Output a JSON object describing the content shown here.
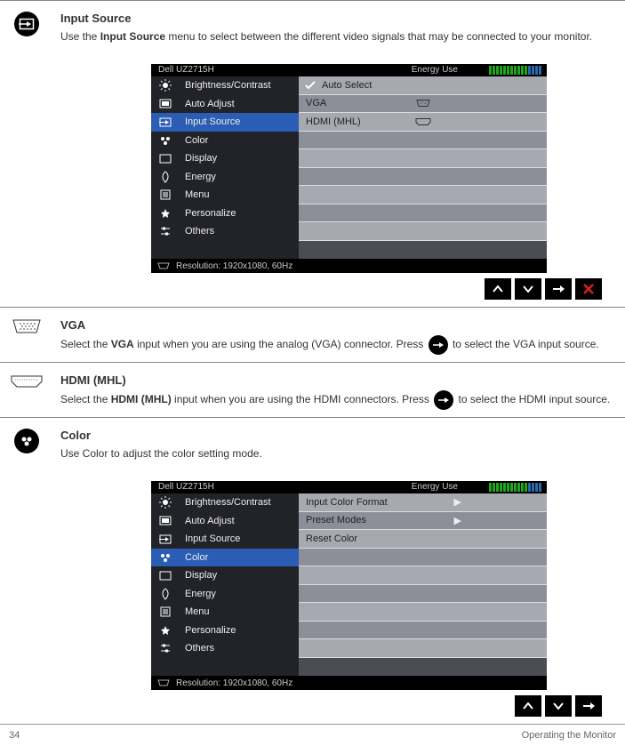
{
  "sections": {
    "input_source": {
      "title": "Input Source",
      "desc_prefix": "Use the ",
      "desc_mid": " menu to select between the different video signals that may be connected to your monitor."
    },
    "vga": {
      "title": "VGA",
      "desc_prefix": "Select the ",
      "desc_label": "VGA",
      "desc_mid": " input when you are using the analog (VGA) connector. Press ",
      "desc_suffix": " to select the VGA input source."
    },
    "hdmi": {
      "title": "HDMI (MHL)",
      "desc_prefix": "Select the ",
      "desc_label": "HDMI (MHL)",
      "desc_mid": " input when you are using the HDMI connectors. Press ",
      "desc_suffix": " to select the HDMI input source."
    },
    "color": {
      "title": "Color",
      "desc": "Use Color to adjust the color setting mode."
    }
  },
  "osd1": {
    "brand": "Dell UZ2715H",
    "resolution": "Resolution: 1920x1080, 60Hz",
    "menu": [
      {
        "label": "Brightness/Contrast",
        "value": "Auto Select",
        "check": true
      },
      {
        "label": "Auto Adjust",
        "value": "VGA",
        "port": "vga"
      },
      {
        "label": "Input Source",
        "value": "HDMI (MHL)",
        "port": "hdmi",
        "selected": true
      },
      {
        "label": "Color",
        "value": ""
      },
      {
        "label": "Display",
        "value": ""
      },
      {
        "label": "Energy",
        "value": ""
      },
      {
        "label": "Menu",
        "value": ""
      },
      {
        "label": "Personalize",
        "value": ""
      },
      {
        "label": "Others",
        "value": ""
      },
      {
        "label": "",
        "value": ""
      }
    ],
    "nav": [
      "up",
      "down",
      "right",
      "close"
    ]
  },
  "osd2": {
    "brand": "Dell UZ2715H",
    "resolution": "Resolution: 1920x1080, 60Hz",
    "menu": [
      {
        "label": "Brightness/Contrast",
        "value": "Input Color Format",
        "caret": true
      },
      {
        "label": "Auto Adjust",
        "value": "Preset Modes",
        "caret": true
      },
      {
        "label": "Input Source",
        "value": "Reset Color"
      },
      {
        "label": "Color",
        "value": "",
        "selected": true
      },
      {
        "label": "Display",
        "value": ""
      },
      {
        "label": "Energy",
        "value": ""
      },
      {
        "label": "Menu",
        "value": ""
      },
      {
        "label": "Personalize",
        "value": ""
      },
      {
        "label": "Others",
        "value": ""
      },
      {
        "label": "",
        "value": ""
      }
    ],
    "nav": [
      "up",
      "down",
      "right"
    ]
  },
  "footer": {
    "page": "34",
    "section": "Operating the Monitor"
  }
}
